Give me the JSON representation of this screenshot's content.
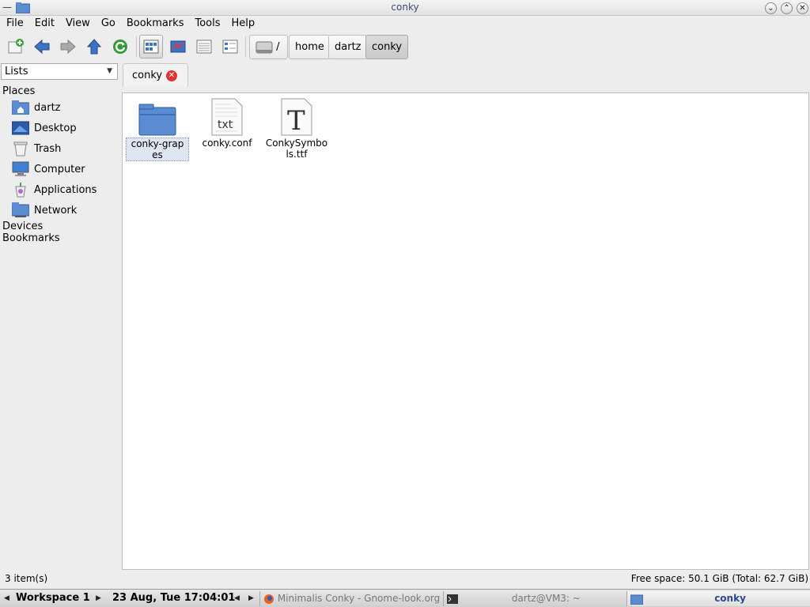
{
  "window": {
    "title": "conky",
    "menu_glyph": "—",
    "btn_min": "⌄",
    "btn_max": "⌃",
    "btn_close": "✕"
  },
  "menubar": {
    "items": [
      "File",
      "Edit",
      "View",
      "Go",
      "Bookmarks",
      "Tools",
      "Help"
    ]
  },
  "path": {
    "root": "/",
    "crumbs": [
      "home",
      "dartz",
      "conky"
    ]
  },
  "sidebar": {
    "mode": "Lists",
    "places_heading": "Places",
    "places": [
      "dartz",
      "Desktop",
      "Trash",
      "Computer",
      "Applications",
      "Network"
    ],
    "devices_heading": "Devices",
    "bookmarks_heading": "Bookmarks"
  },
  "tab": {
    "label": "conky",
    "close_glyph": "✕"
  },
  "files": [
    {
      "name": "conky-grapes",
      "kind": "folder",
      "selected": true
    },
    {
      "name": "conky.conf",
      "kind": "text",
      "icon_text": "txt"
    },
    {
      "name": "ConkySymbols.ttf",
      "kind": "font",
      "icon_text": "T"
    }
  ],
  "status": {
    "items": "3 item(s)",
    "free_space": "Free space: 50.1 GiB (Total: 62.7 GiB)"
  },
  "panel": {
    "workspace": "Workspace 1",
    "datetime": "23 Aug, Tue 17:04:01",
    "tasks": [
      "Minimalis Conky - Gnome-look.org — M",
      "dartz@VM3: ~",
      "conky"
    ],
    "arrow_left": "◀",
    "arrow_right": "▶"
  },
  "colors": {
    "folder_blue": "#5b8cd1",
    "title_text": "#3a4a72"
  }
}
